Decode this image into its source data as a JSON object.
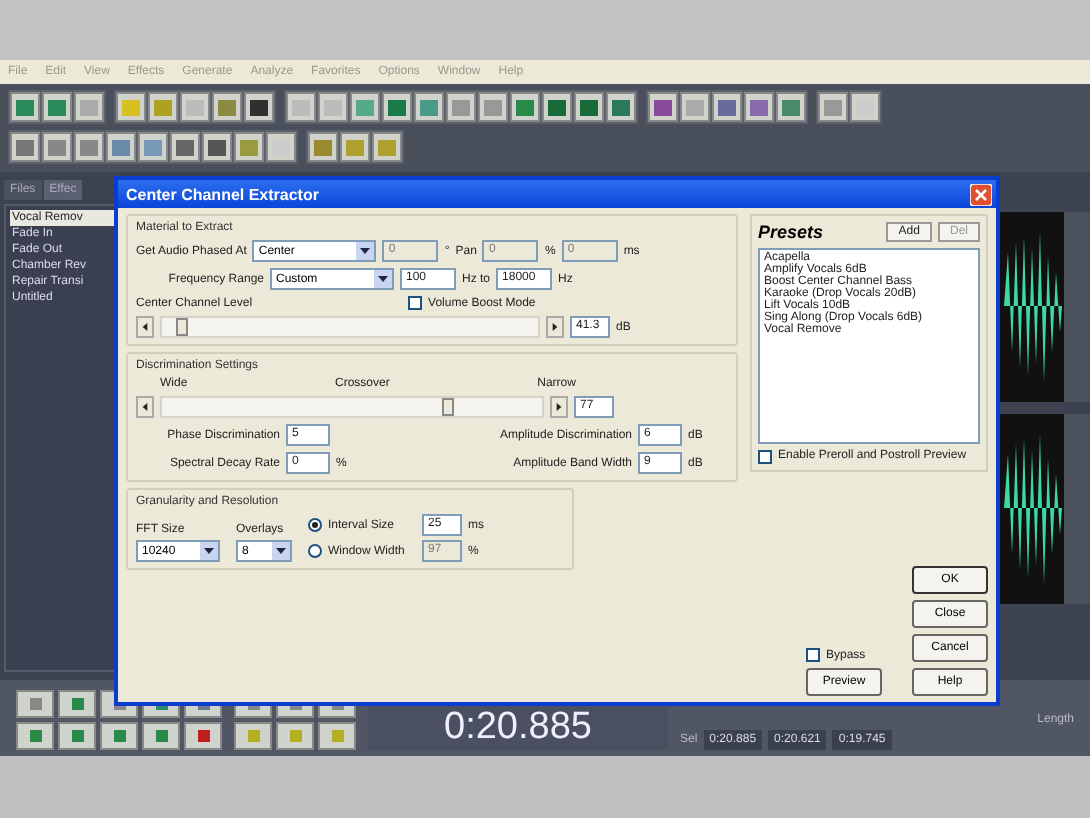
{
  "menu": [
    "File",
    "Edit",
    "View",
    "Effects",
    "Generate",
    "Analyze",
    "Favorites",
    "Options",
    "Window",
    "Help"
  ],
  "side_panel": {
    "tabs": [
      {
        "label": "Files",
        "selected": false
      },
      {
        "label": "Effec",
        "selected": true
      }
    ],
    "items": [
      {
        "label": "Vocal Remov",
        "selected": true
      },
      {
        "label": "Fade In",
        "selected": false
      },
      {
        "label": "Fade Out",
        "selected": false
      },
      {
        "label": "Chamber Rev",
        "selected": false
      },
      {
        "label": "Repair Transi",
        "selected": false
      },
      {
        "label": "Untitled",
        "selected": false
      }
    ]
  },
  "dialog": {
    "title": "Center Channel Extractor",
    "material": {
      "title": "Material to Extract",
      "phase_label": "Get Audio Phased At",
      "phase_value": "Center",
      "degree_value": "0",
      "degree_unit": "°",
      "pan_label": "Pan",
      "pan_value": "0",
      "pan_unit": "%",
      "delay_value": "0",
      "delay_unit": "ms",
      "range_label": "Frequency Range",
      "range_value": "Custom",
      "range_from": "100",
      "range_to_label": "Hz to",
      "range_to": "18000",
      "range_unit": "Hz",
      "level_label": "Center Channel Level",
      "boost": {
        "label": "Volume Boost Mode",
        "checked": false
      },
      "level": 0.04,
      "level_value": "41.3",
      "level_unit": "dB"
    },
    "discrimination": {
      "title": "Discrimination Settings",
      "wide_label": "Wide",
      "crossover_label": "Crossover",
      "narrow_label": "Narrow",
      "level": 0.76,
      "value": "77",
      "fields": [
        {
          "label": "Phase Discrimination",
          "value": "5"
        },
        {
          "label": "Amplitude Discrimination",
          "value": "6",
          "unit": "dB"
        },
        {
          "label": "Spectral Decay Rate",
          "value": "0",
          "unit": "%"
        },
        {
          "label": "Amplitude Band Width",
          "value": "9",
          "unit": "dB"
        }
      ]
    },
    "granularity": {
      "title": "Granularity and Resolution",
      "fft_label": "FFT Size",
      "fft_value": "10240",
      "overlays_label": "Overlays",
      "overlays_value": "8",
      "options": [
        {
          "label": "Interval Size",
          "value": "25",
          "unit": "ms",
          "selected": true
        },
        {
          "label": "Window Width",
          "value": "97",
          "unit": "%",
          "selected": false
        }
      ]
    },
    "presets": {
      "title": "Presets",
      "add": "Add",
      "del": "Del",
      "items": [
        "Acapella",
        "Amplify Vocals 6dB",
        "Boost Center Channel Bass",
        "Karaoke (Drop Vocals 20dB)",
        "Lift Vocals 10dB",
        "Sing Along (Drop Vocals 6dB)",
        "Vocal Remove"
      ],
      "preroll": {
        "label": "Enable Preroll and Postroll Preview",
        "checked": false
      }
    },
    "buttons": {
      "ok": "OK",
      "close": "Close",
      "cancel": "Cancel",
      "help": "Help",
      "preview": "Preview"
    },
    "bypass": {
      "label": "Bypass",
      "checked": false
    }
  },
  "transport": {
    "time": "0:20.885",
    "length_label": "Length",
    "sel_label": "Sel",
    "sel_values": [
      "0:20.885",
      "0:20.621",
      "0:19.745"
    ]
  }
}
